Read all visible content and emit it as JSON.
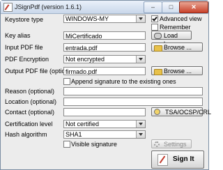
{
  "window": {
    "title": "JSignPdf (version 1.6.1)",
    "minimize_glyph": "–",
    "maximize_glyph": "□",
    "close_glyph": "✕"
  },
  "form": {
    "keystore_type": {
      "label": "Keystore type",
      "value": "WINDOWS-MY"
    },
    "advanced_view": {
      "label": "Advanced view",
      "checked": true
    },
    "remember_passwords": {
      "label": "Remember passwords",
      "checked": false
    },
    "key_alias": {
      "label": "Key alias",
      "value": "MiCertificado"
    },
    "load_keys_label": "Load keys",
    "input_pdf": {
      "label": "Input PDF file",
      "value": "entrada.pdf"
    },
    "browse_label": "Browse ...",
    "pdf_encryption": {
      "label": "PDF Encryption",
      "value": "Not encrypted"
    },
    "output_pdf": {
      "label": "Output PDF file (optional)",
      "value": "firmado.pdf"
    },
    "append_signature": {
      "label": "Append signature to the existing ones",
      "checked": false
    },
    "reason": {
      "label": "Reason (optional)",
      "value": ""
    },
    "location": {
      "label": "Location (optional)",
      "value": ""
    },
    "contact": {
      "label": "Contact (optional)",
      "value": ""
    },
    "tsa_label": "TSA/OCSP/CRL",
    "certification_level": {
      "label": "Certification level",
      "value": "Not certified"
    },
    "hash_algorithm": {
      "label": "Hash algorithm",
      "value": "SHA1"
    },
    "visible_signature": {
      "label": "Visible signature",
      "checked": false
    },
    "settings_label": "Settings",
    "sign_label": "Sign It"
  },
  "icons": [
    "app-icon",
    "key-icon",
    "folder-icon",
    "gear-icon",
    "tsa-icon",
    "sign-icon"
  ],
  "colors": {
    "titlebar": "#c9d7ea",
    "background": "#ececec",
    "close_button": "#c9412a"
  }
}
